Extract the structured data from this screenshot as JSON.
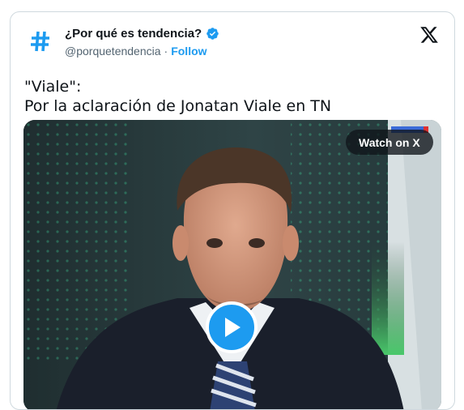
{
  "account": {
    "name": "¿Por qué es tendencia?",
    "handle": "@porquetendencia",
    "separator": "·",
    "follow_label": "Follow",
    "avatar_icon": "hashtag-icon",
    "verified_icon": "verified-badge-icon"
  },
  "tweet": {
    "text": "\"Viale\":\nPor la aclaración de Jonatan Viale en TN"
  },
  "media": {
    "watch_label": "Watch on X",
    "play_icon": "play-icon"
  },
  "colors": {
    "accent": "#1d9bf0",
    "text": "#0f1419",
    "secondary_text": "#536471",
    "border": "#cfd9de"
  }
}
